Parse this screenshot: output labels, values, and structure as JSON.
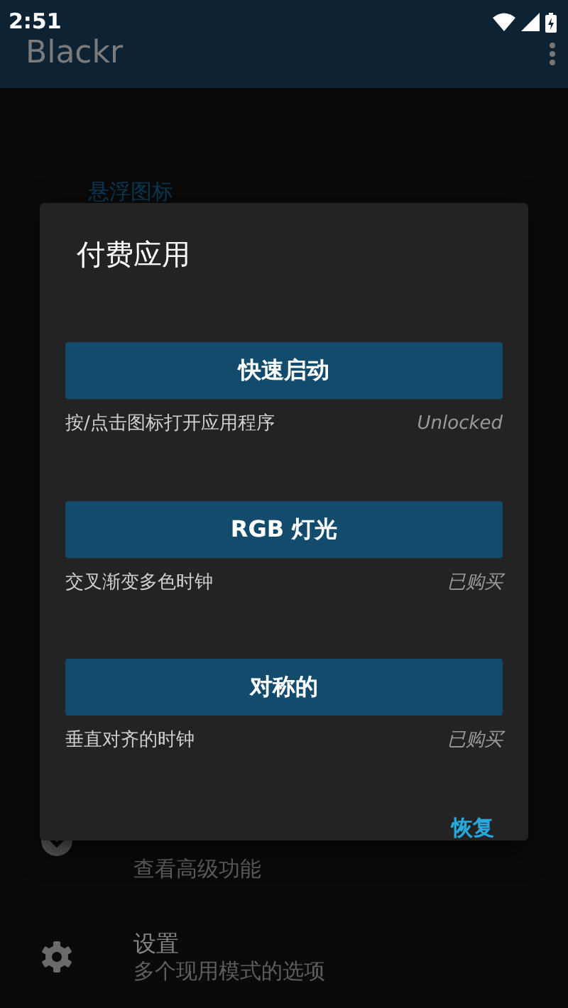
{
  "status_bar": {
    "time": "2:51"
  },
  "app_bar": {
    "title": "Blackr"
  },
  "background": {
    "section_header": "悬浮图标",
    "items": [
      {
        "kind": "upgrade",
        "subtitle": "查看高级功能"
      },
      {
        "kind": "settings",
        "title": "设置",
        "subtitle": "多个现用模式的选项"
      }
    ]
  },
  "dialog": {
    "title": "付费应用",
    "products": [
      {
        "name": "快速启动",
        "description": "按/点击图标打开应用程序",
        "status": "Unlocked"
      },
      {
        "name": "RGB 灯光",
        "description": "交叉渐变多色时钟",
        "status": "已购买"
      },
      {
        "name": "对称的",
        "description": "垂直对齐的时钟",
        "status": "已购买"
      }
    ],
    "action": "恢复"
  }
}
